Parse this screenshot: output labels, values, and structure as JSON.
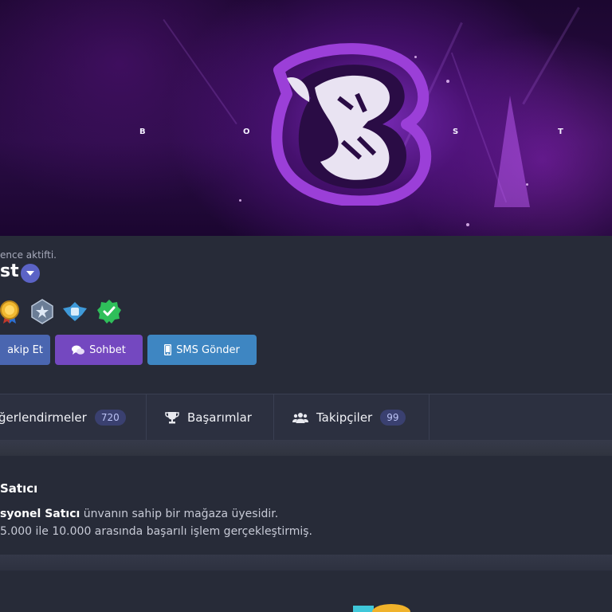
{
  "banner": {
    "letters": [
      "B",
      "O",
      "O",
      "S",
      "T"
    ],
    "logo_letter": "B"
  },
  "profile": {
    "status_text": "ence aktifti.",
    "name_fragment": "st",
    "badges": [
      "gold-medal-icon",
      "silver-star-badge-icon",
      "blue-wings-badge-icon",
      "green-verified-icon"
    ],
    "buttons": {
      "follow": "akip Et",
      "chat": "Sohbet",
      "sms": "SMS Gönder"
    }
  },
  "tabs": [
    {
      "label": "ğerlendirmeler",
      "count": "720"
    },
    {
      "label": "Başarımlar"
    },
    {
      "label": "Takipçiler",
      "count": "99"
    }
  ],
  "card": {
    "title": "Satıcı",
    "line1_bold": "syonel Satıcı",
    "line1_rest": " ünvanın sahip bir mağaza üyesidir.",
    "line2": "5.000 ile 10.000 arasında başarılı işlem gerçekleştirmiş."
  },
  "colors": {
    "page_bg": "#272b38",
    "follow_button": "#4a66b0",
    "chat_button": "#7448c0",
    "sms_button": "#3e86c2",
    "tab_count_bg": "#3a4070",
    "brand_purple": "#9b3fd8"
  }
}
